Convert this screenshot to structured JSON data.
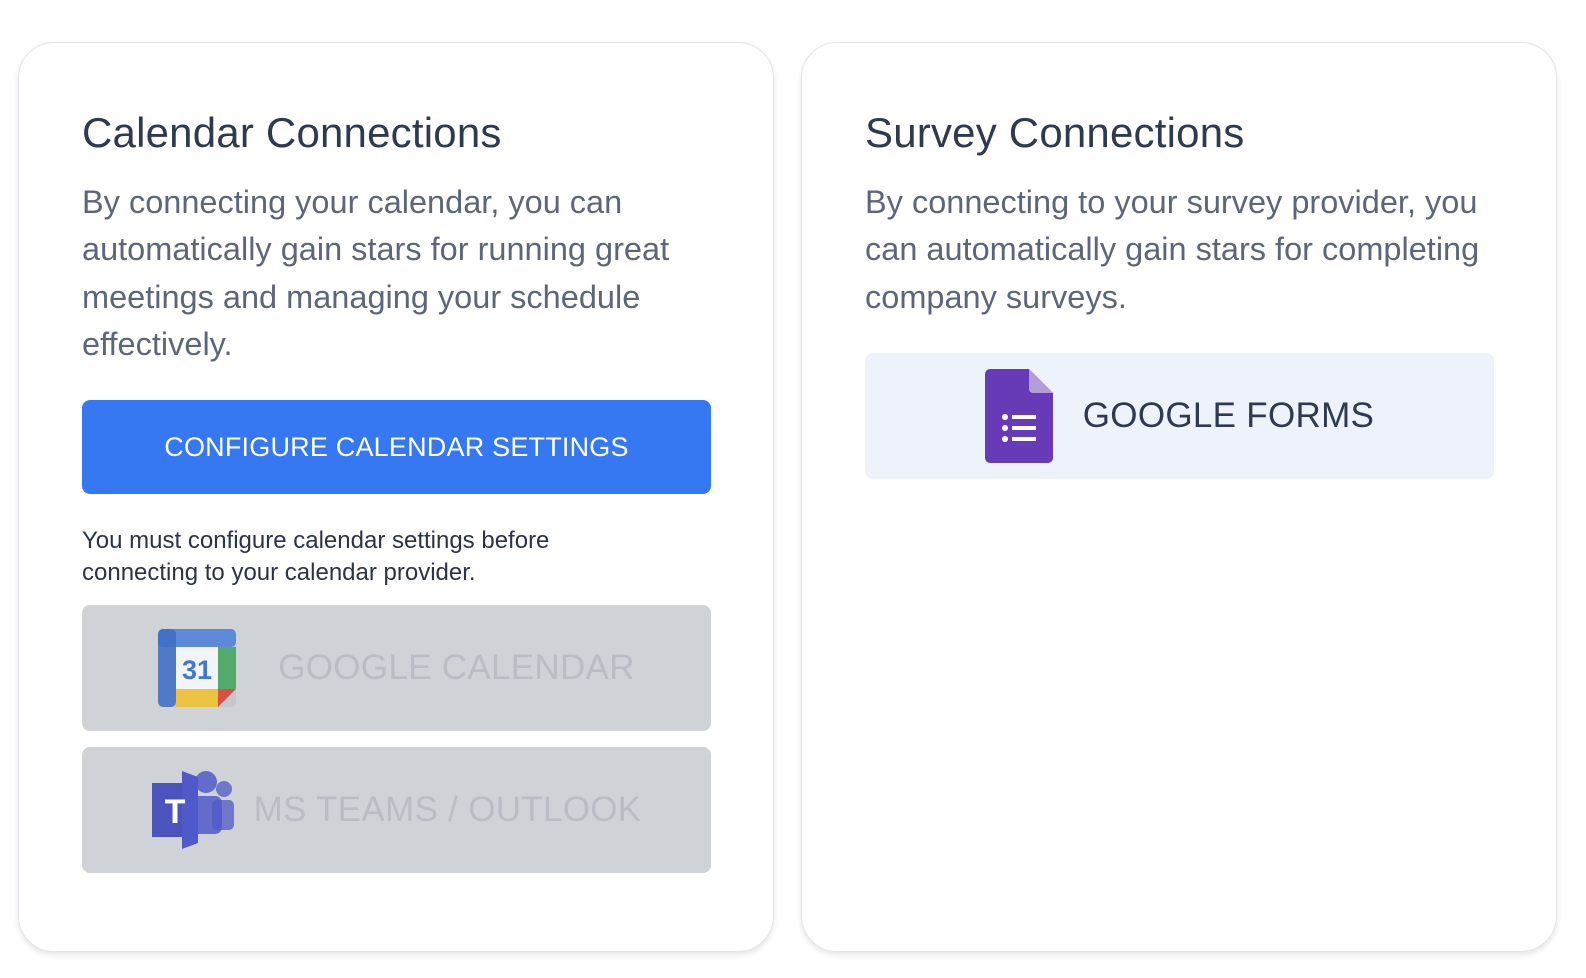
{
  "calendar_card": {
    "title": "Calendar Connections",
    "description": "By connecting your calendar, you can automatically gain stars for running great meetings and managing your schedule effectively.",
    "configure_button_label": "CONFIGURE CALENDAR SETTINGS",
    "note": "You must configure calendar settings before connecting to your calendar provider.",
    "providers": [
      {
        "label": "GOOGLE CALENDAR",
        "icon": "google-calendar-icon",
        "icon_text": "31",
        "enabled": false
      },
      {
        "label": "MS TEAMS / OUTLOOK",
        "icon": "ms-teams-icon",
        "icon_text": "T",
        "enabled": false
      }
    ]
  },
  "survey_card": {
    "title": "Survey Connections",
    "description": "By connecting to your survey provider, you can automatically gain stars for completing company surveys.",
    "providers": [
      {
        "label": "GOOGLE FORMS",
        "icon": "google-forms-icon",
        "enabled": true
      }
    ]
  },
  "colors": {
    "primary": "#3578f1",
    "disabled_bg": "#cfd2d7",
    "forms_bg": "#eef3fb",
    "forms_purple": "#673ab7",
    "teams_purple": "#5059c9"
  }
}
